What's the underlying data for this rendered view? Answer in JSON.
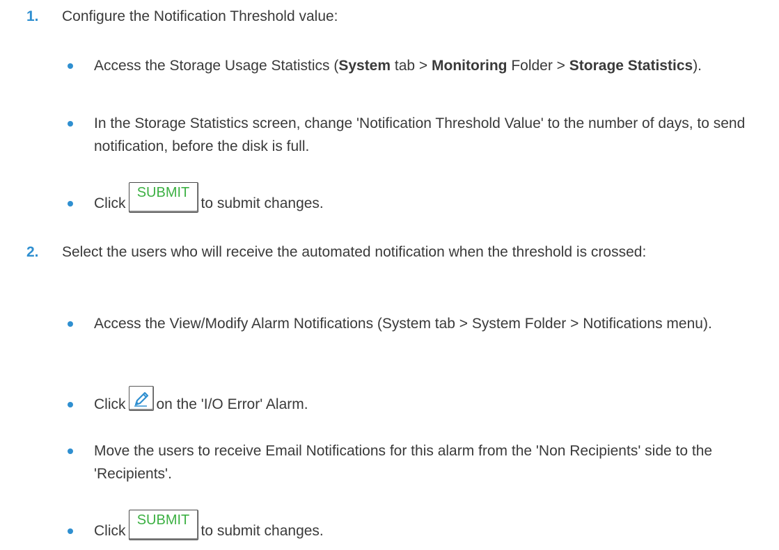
{
  "steps": [
    {
      "number": "1.",
      "text": "Configure the Notification Threshold value:",
      "bullets": [
        {
          "parts": [
            "Access the Storage Usage Statistics (",
            "System",
            " tab > ",
            "Monitoring",
            " Folder > ",
            "Storage Statistics",
            ")."
          ]
        },
        {
          "text": "In the Storage Statistics screen, change 'Notification Threshold Value' to the number of days, to send notification, before the disk is full."
        },
        {
          "prefix": "Click",
          "button_label": "SUBMIT",
          "suffix": "to submit changes."
        }
      ]
    },
    {
      "number": "2.",
      "text": "Select the users who will receive the automated notification when the threshold is crossed:",
      "bullets": [
        {
          "text": "Access the View/Modify Alarm Notifications (System tab > System Folder > Notifications menu)."
        },
        {
          "prefix": "Click",
          "icon": "pencil-edit-icon",
          "suffix": "on the 'I/O Error' Alarm."
        },
        {
          "text": "Move the users to receive Email Notifications for this alarm from the 'Non Recipients' side to the 'Recipients'."
        },
        {
          "prefix": "Click",
          "button_label": "SUBMIT",
          "suffix": "to submit changes."
        }
      ]
    }
  ],
  "colors": {
    "accent": "#2f8fd0",
    "submit_text": "#3cb043",
    "body_text": "#3a3a3a"
  }
}
